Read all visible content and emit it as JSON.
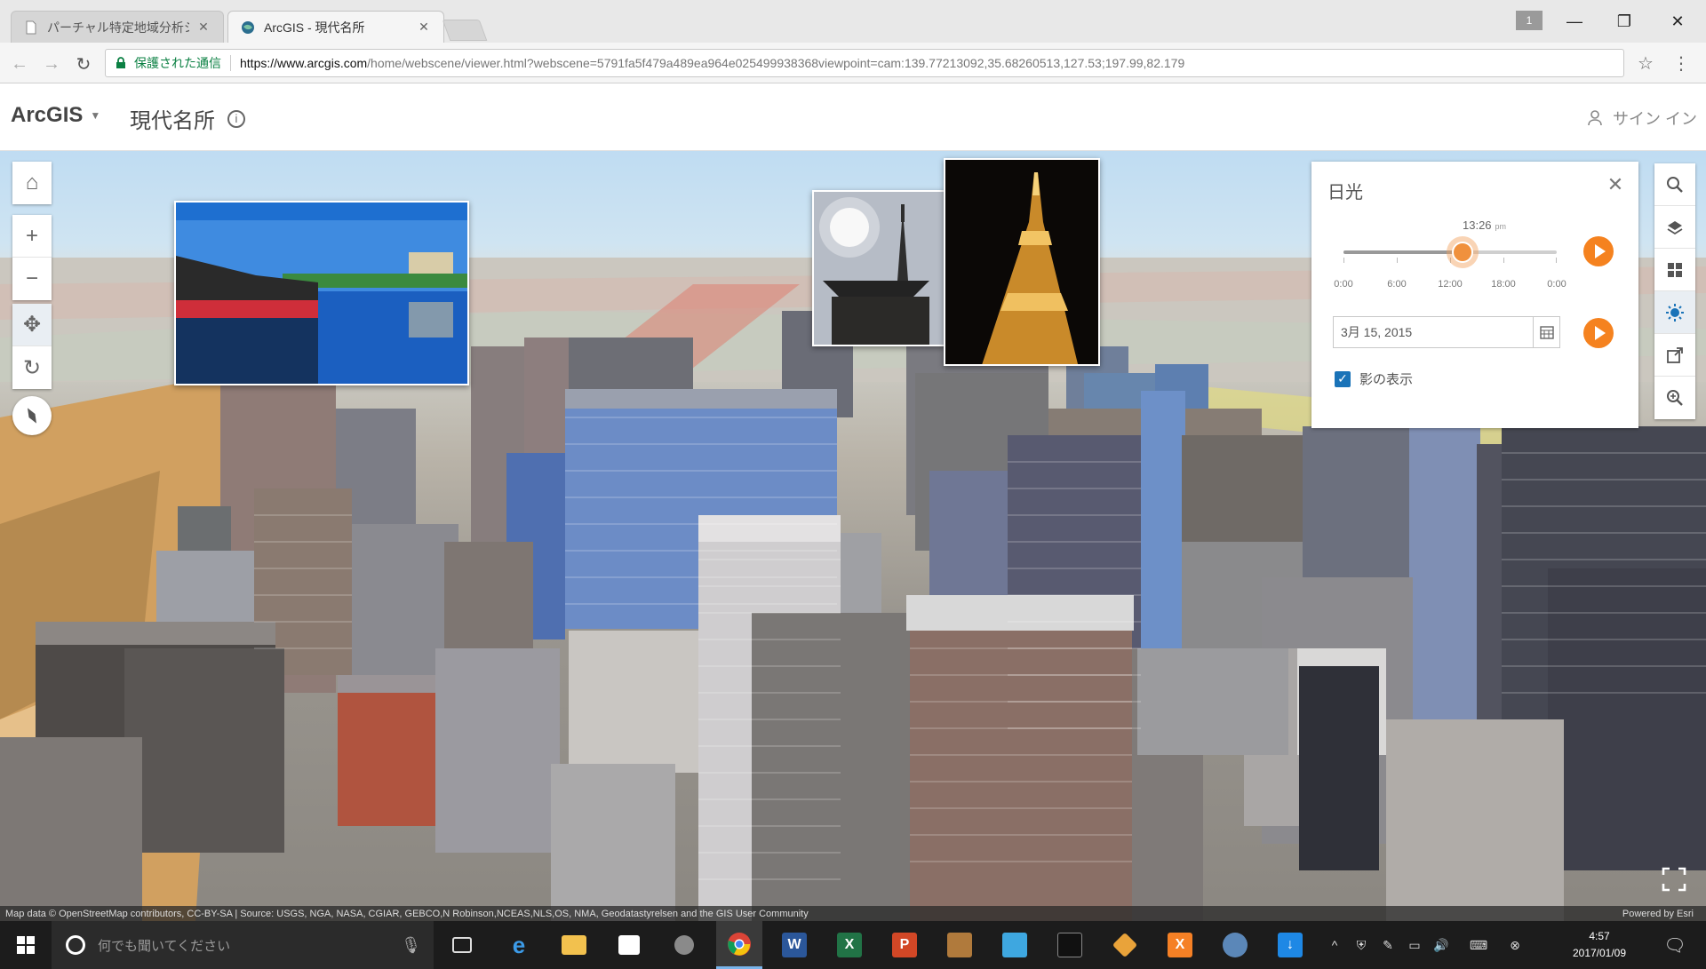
{
  "browser": {
    "tabs": [
      {
        "title": "パーチャル特定地域分析シス",
        "active": false
      },
      {
        "title": "ArcGIS - 現代名所",
        "active": true
      }
    ],
    "user_badge": "1",
    "secure_label": "保護された通信",
    "url_host": "https://www.arcgis.com",
    "url_path": "/home/webscene/viewer.html?webscene=5791fa5f479a489ea964e025499938368viewpoint=cam:139.77213092,35.68260513,127.53;197.99,82.179"
  },
  "app": {
    "brand": "ArcGIS",
    "scene_title": "現代名所",
    "signin_label": "サイン イン"
  },
  "daylight_panel": {
    "title": "日光",
    "time_value": "13:26",
    "time_ampm": "pm",
    "slider_fraction": 0.56,
    "tick_labels": [
      "0:00",
      "6:00",
      "12:00",
      "18:00",
      "0:00"
    ],
    "date_value": "3月 15, 2015",
    "shadow_label": "影の表示",
    "shadow_checked": true,
    "accent_color": "#f5821f"
  },
  "attribution": {
    "text": "Map data © OpenStreetMap contributors, CC-BY-SA | Source: USGS, NGA, NASA, CGIAR, GEBCO,N Robinson,NCEAS,NLS,OS, NMA, Geodatastyrelsen and the GIS User Community",
    "powered": "Powered by Esri"
  },
  "taskbar": {
    "search_placeholder": "何でも聞いてください",
    "clock_time": "4:57",
    "clock_date": "2017/01/09"
  }
}
